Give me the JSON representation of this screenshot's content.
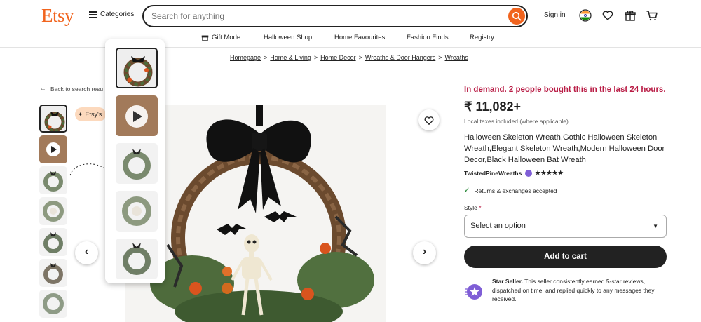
{
  "header": {
    "logo": "Etsy",
    "categories_label": "Categories",
    "search_placeholder": "Search for anything",
    "signin_label": "Sign in",
    "accent_color": "#f1641e"
  },
  "nav": {
    "items": [
      "Gift Mode",
      "Halloween Shop",
      "Home Favourites",
      "Fashion Finds",
      "Registry"
    ]
  },
  "breadcrumb": {
    "items": [
      "Homepage",
      "Home & Living",
      "Home Decor",
      "Wreaths & Door Hangers",
      "Wreaths"
    ],
    "separator": ">"
  },
  "gallery": {
    "back_label": "Back to search resu",
    "badge_label": "Etsy's",
    "thumbnail_count": 7,
    "selected_index": 0
  },
  "product": {
    "demand_text": "In demand. 2 people bought this in the last 24 hours.",
    "price": "₹ 11,082+",
    "tax_note": "Local taxes included (where applicable)",
    "title": "Halloween Skeleton Wreath,Gothic Halloween Skeleton Wreath,Elegant Skeleton Wreath,Modern Halloween Door Decor,Black Halloween Bat Wreath",
    "shop_name": "TwistedPineWreaths",
    "rating_stars": "★★★★★",
    "rating": 5,
    "returns_text": "Returns & exchanges accepted",
    "style_label": "Style",
    "style_required": "*",
    "select_value": "Select an option",
    "cart_button": "Add to cart",
    "star_seller_title": "Star Seller.",
    "star_seller_text": " This seller consistently earned 5-star reviews, dispatched on time, and replied quickly to any messages they received."
  },
  "colors": {
    "demand": "#b91c45",
    "cart_button": "#222222",
    "star_seller_badge": "#7f5ed6",
    "check": "#258635"
  },
  "icons": {
    "search": "search-icon",
    "account": "globe-icon",
    "favorites": "heart-icon",
    "gifts": "gift-icon",
    "cart": "cart-icon"
  }
}
